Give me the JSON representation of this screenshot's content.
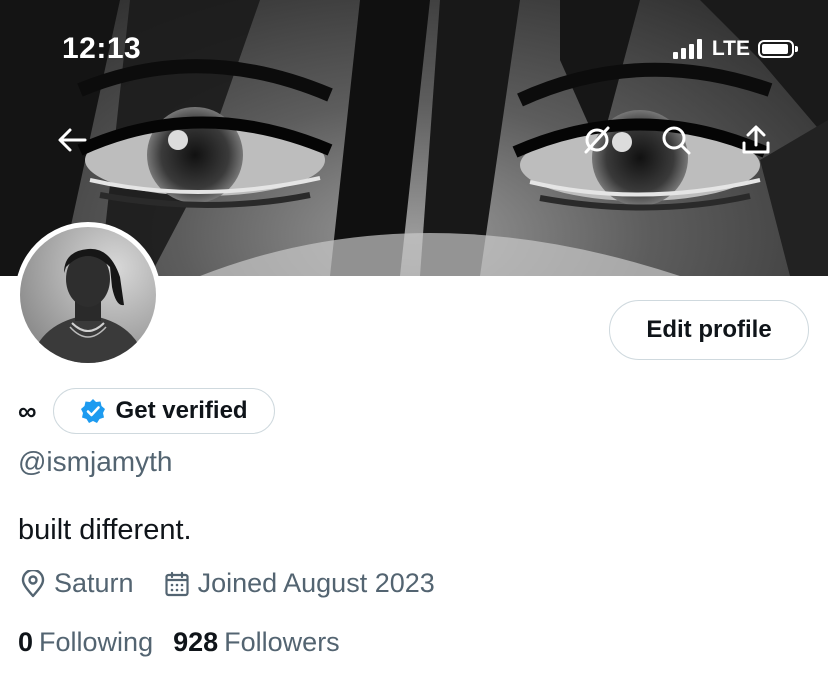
{
  "status_bar": {
    "time": "12:13",
    "network": "LTE"
  },
  "header": {
    "icons": [
      "back-arrow-icon",
      "circle-slash-icon",
      "search-icon",
      "share-icon"
    ]
  },
  "profile": {
    "display_name": "∞",
    "get_verified_label": "Get verified",
    "handle": "@ismjamyth",
    "bio": "built different.",
    "location": "Saturn",
    "joined": "Joined August 2023",
    "following_count": "0",
    "following_label": "Following",
    "followers_count": "928",
    "followers_label": "Followers"
  },
  "actions": {
    "edit_profile_label": "Edit profile"
  },
  "colors": {
    "verified_blue": "#1d9bf0",
    "secondary_text": "#536471",
    "border": "#cfd9de"
  }
}
